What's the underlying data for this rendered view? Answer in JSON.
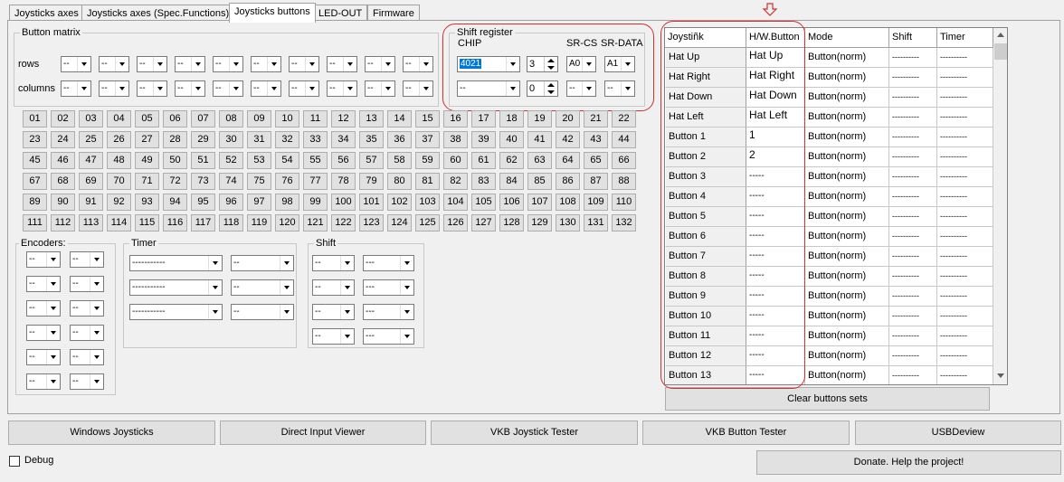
{
  "tabs": [
    {
      "label": "Joysticks axes"
    },
    {
      "label": "Joysticks axes (Spec.Functions)"
    },
    {
      "label": "Joysticks buttons"
    },
    {
      "label": "LED-OUT"
    },
    {
      "label": "Firmware"
    }
  ],
  "button_matrix": {
    "label": "Button matrix",
    "rows_label": "rows",
    "columns_label": "columns",
    "combo_value": "--"
  },
  "shift_register": {
    "label": "Shift register",
    "chip_label": "CHIP",
    "srcs_label": "SR-CS",
    "srdata_label": "SR-DATA",
    "row1": {
      "chip": "4021",
      "spin": "3",
      "srcs": "A0",
      "srdata": "A1"
    },
    "row2": {
      "chip": "--",
      "spin": "0",
      "srcs": "--",
      "srdata": "--"
    }
  },
  "number_buttons": [
    "01",
    "02",
    "03",
    "04",
    "05",
    "06",
    "07",
    "08",
    "09",
    "10",
    "11",
    "12",
    "13",
    "14",
    "15",
    "16",
    "17",
    "18",
    "19",
    "20",
    "21",
    "22",
    "23",
    "24",
    "25",
    "26",
    "27",
    "28",
    "29",
    "30",
    "31",
    "32",
    "33",
    "34",
    "35",
    "36",
    "37",
    "38",
    "39",
    "40",
    "41",
    "42",
    "43",
    "44",
    "45",
    "46",
    "47",
    "48",
    "49",
    "50",
    "51",
    "52",
    "53",
    "54",
    "55",
    "56",
    "57",
    "58",
    "59",
    "60",
    "61",
    "62",
    "63",
    "64",
    "65",
    "66",
    "67",
    "68",
    "69",
    "70",
    "71",
    "72",
    "73",
    "74",
    "75",
    "76",
    "77",
    "78",
    "79",
    "80",
    "81",
    "82",
    "83",
    "84",
    "85",
    "86",
    "87",
    "88",
    "89",
    "90",
    "91",
    "92",
    "93",
    "94",
    "95",
    "96",
    "97",
    "98",
    "99",
    "100",
    "101",
    "102",
    "103",
    "104",
    "105",
    "106",
    "107",
    "108",
    "109",
    "110",
    "111",
    "112",
    "113",
    "114",
    "115",
    "116",
    "117",
    "118",
    "119",
    "120",
    "121",
    "122",
    "123",
    "124",
    "125",
    "126",
    "127",
    "128",
    "129",
    "130",
    "131",
    "132"
  ],
  "encoders": {
    "label": "Encoders:",
    "value": "--"
  },
  "timer": {
    "label": "Timer",
    "value_a": "-----------",
    "value_b": "--"
  },
  "shift": {
    "label": "Shift",
    "value_a": "--",
    "value_b": "---"
  },
  "grid": {
    "headers": [
      "Joystiñk",
      "H/W.Button",
      "Mode",
      "Shift",
      "Timer"
    ],
    "rows": [
      {
        "name": "Hat Up",
        "hw": "Hat Up",
        "mode": "Button(norm)",
        "shift": "----------",
        "timer": "----------"
      },
      {
        "name": "Hat Right",
        "hw": "Hat Right",
        "mode": "Button(norm)",
        "shift": "----------",
        "timer": "----------"
      },
      {
        "name": "Hat Down",
        "hw": "Hat Down",
        "mode": "Button(norm)",
        "shift": "----------",
        "timer": "----------"
      },
      {
        "name": "Hat Left",
        "hw": "Hat Left",
        "mode": "Button(norm)",
        "shift": "----------",
        "timer": "----------"
      },
      {
        "name": "Button 1",
        "hw": "1",
        "mode": "Button(norm)",
        "shift": "----------",
        "timer": "----------"
      },
      {
        "name": "Button 2",
        "hw": "2",
        "mode": "Button(norm)",
        "shift": "----------",
        "timer": "----------"
      },
      {
        "name": "Button 3",
        "hw": "-----",
        "mode": "Button(norm)",
        "shift": "----------",
        "timer": "----------"
      },
      {
        "name": "Button 4",
        "hw": "-----",
        "mode": "Button(norm)",
        "shift": "----------",
        "timer": "----------"
      },
      {
        "name": "Button 5",
        "hw": "-----",
        "mode": "Button(norm)",
        "shift": "----------",
        "timer": "----------"
      },
      {
        "name": "Button 6",
        "hw": "-----",
        "mode": "Button(norm)",
        "shift": "----------",
        "timer": "----------"
      },
      {
        "name": "Button 7",
        "hw": "-----",
        "mode": "Button(norm)",
        "shift": "----------",
        "timer": "----------"
      },
      {
        "name": "Button 8",
        "hw": "-----",
        "mode": "Button(norm)",
        "shift": "----------",
        "timer": "----------"
      },
      {
        "name": "Button 9",
        "hw": "-----",
        "mode": "Button(norm)",
        "shift": "----------",
        "timer": "----------"
      },
      {
        "name": "Button 10",
        "hw": "-----",
        "mode": "Button(norm)",
        "shift": "----------",
        "timer": "----------"
      },
      {
        "name": "Button 11",
        "hw": "-----",
        "mode": "Button(norm)",
        "shift": "----------",
        "timer": "----------"
      },
      {
        "name": "Button 12",
        "hw": "-----",
        "mode": "Button(norm)",
        "shift": "----------",
        "timer": "----------"
      },
      {
        "name": "Button 13",
        "hw": "-----",
        "mode": "Button(norm)",
        "shift": "----------",
        "timer": "----------"
      }
    ]
  },
  "clear_button": "Clear buttons sets",
  "bottom_buttons": [
    "Windows Joysticks",
    "Direct Input Viewer",
    "VKB Joystick Tester",
    "VKB Button Tester",
    "USBDeview"
  ],
  "debug_label": "Debug",
  "donate_button": "Donate. Help the project!",
  "colors": {
    "annotation": "#d03030",
    "selection": "#0078d7"
  }
}
